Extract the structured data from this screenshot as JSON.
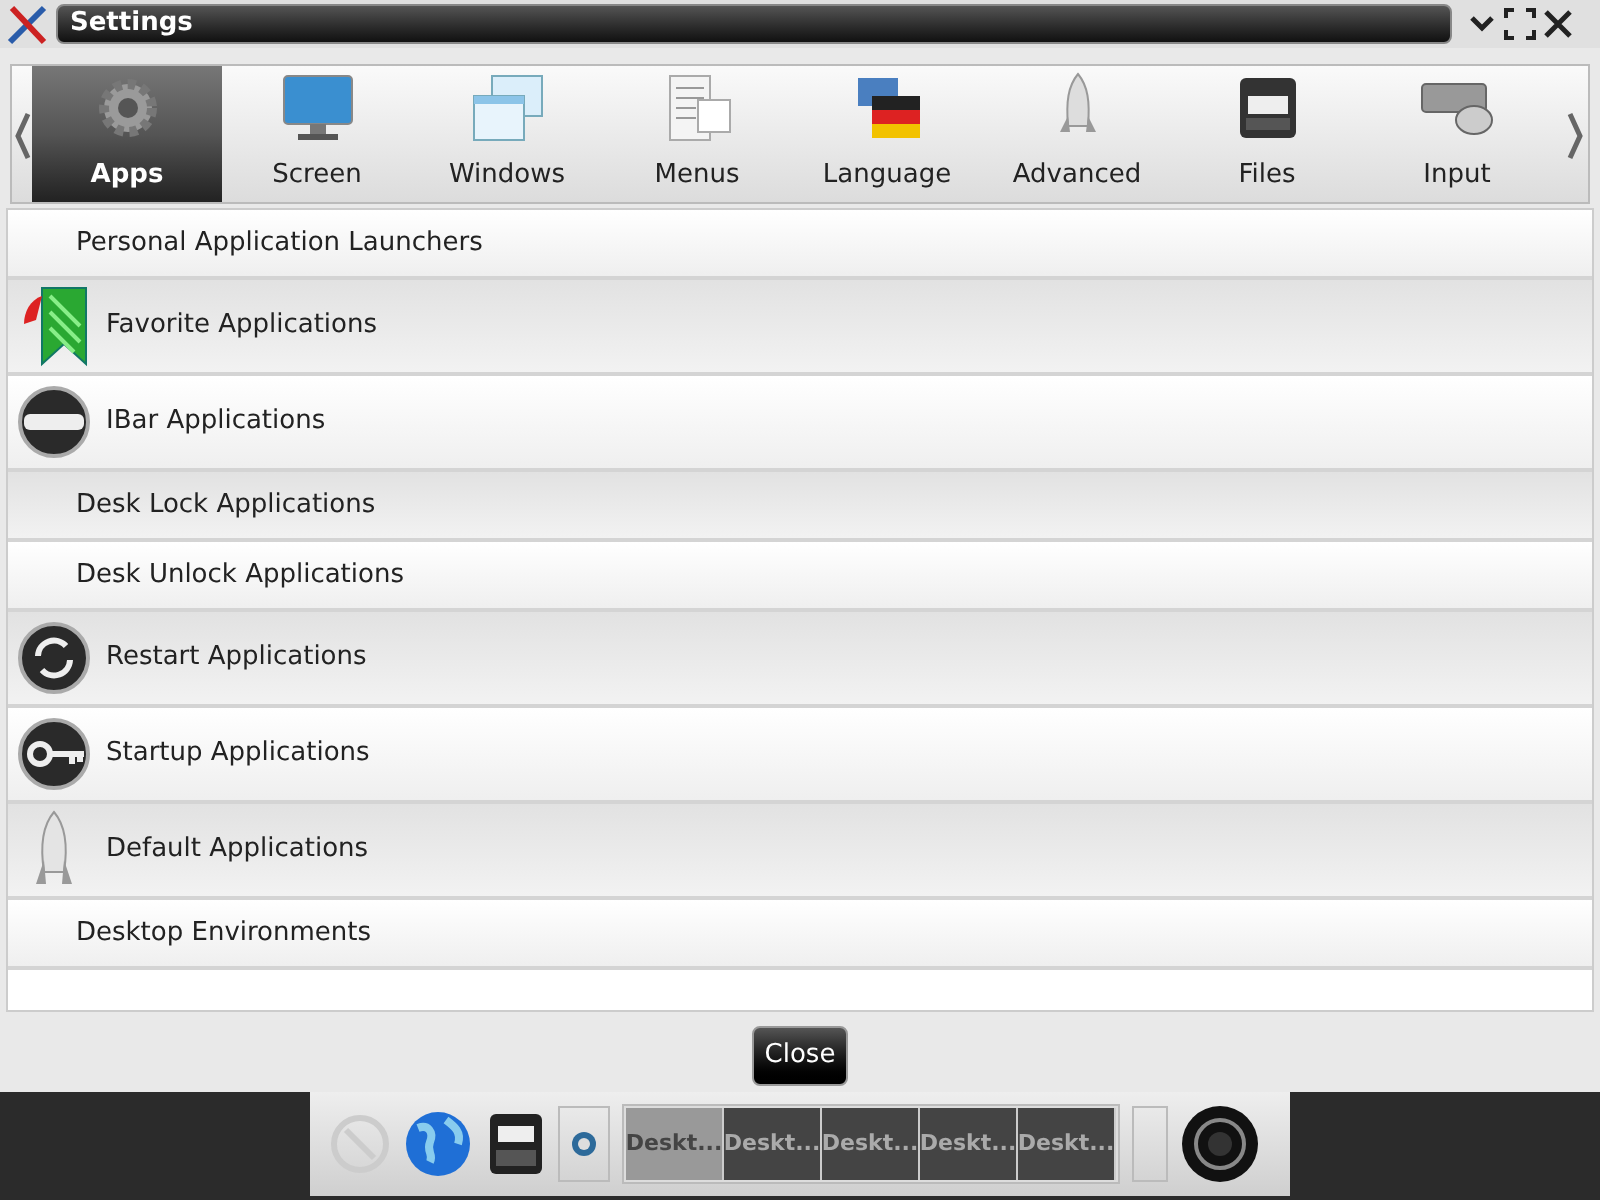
{
  "window": {
    "title": "Settings"
  },
  "tabs": [
    {
      "label": "Apps",
      "kind": "gear",
      "selected": true
    },
    {
      "label": "Screen",
      "kind": "monitor",
      "selected": false
    },
    {
      "label": "Windows",
      "kind": "windows",
      "selected": false
    },
    {
      "label": "Menus",
      "kind": "menus",
      "selected": false
    },
    {
      "label": "Language",
      "kind": "flag",
      "selected": false
    },
    {
      "label": "Advanced",
      "kind": "rocket",
      "selected": false
    },
    {
      "label": "Files",
      "kind": "cabinet",
      "selected": false
    },
    {
      "label": "Input",
      "kind": "mouse",
      "selected": false
    }
  ],
  "items": [
    {
      "label": "Personal Application Launchers",
      "kind": "none"
    },
    {
      "label": "Favorite Applications",
      "kind": "bookmark"
    },
    {
      "label": "IBar Applications",
      "kind": "ibar"
    },
    {
      "label": "Desk Lock Applications",
      "kind": "none"
    },
    {
      "label": "Desk Unlock Applications",
      "kind": "none"
    },
    {
      "label": "Restart Applications",
      "kind": "restart"
    },
    {
      "label": "Startup Applications",
      "kind": "key"
    },
    {
      "label": "Default Applications",
      "kind": "rocket"
    },
    {
      "label": "Desktop Environments",
      "kind": "none"
    }
  ],
  "close_button": "Close",
  "pager": [
    {
      "label": "Deskt...",
      "selected": true
    },
    {
      "label": "Deskt...",
      "selected": false
    },
    {
      "label": "Deskt...",
      "selected": false
    },
    {
      "label": "Deskt...",
      "selected": false
    },
    {
      "label": "Deskt...",
      "selected": false
    }
  ]
}
